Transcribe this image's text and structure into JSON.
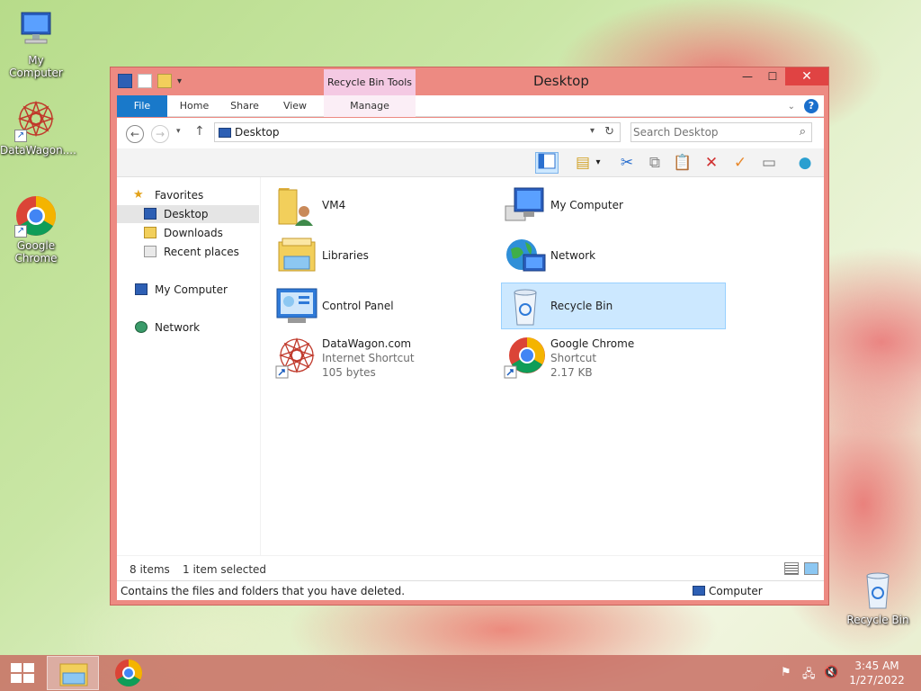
{
  "desktop": {
    "icons": [
      {
        "label": "My Computer"
      },
      {
        "label": "DataWagon...."
      },
      {
        "label": "Google Chrome"
      },
      {
        "label": "Recycle Bin"
      }
    ]
  },
  "window": {
    "title": "Desktop",
    "contextual_tab_group": "Recycle Bin Tools",
    "ribbon_tabs": [
      "File",
      "Home",
      "Share",
      "View",
      "Manage"
    ],
    "address": "Desktop",
    "search_placeholder": "Search Desktop",
    "colors": {
      "frame": "#ed8a82",
      "file_tab": "#1979ca",
      "close": "#e04343",
      "selection": "#cce8ff"
    }
  },
  "nav_pane": {
    "favorites": "Favorites",
    "items": [
      "Desktop",
      "Downloads",
      "Recent places"
    ],
    "computer": "My Computer",
    "network": "Network"
  },
  "files": [
    {
      "name": "VM4",
      "icon": "user-folder-icon"
    },
    {
      "name": "My Computer",
      "icon": "computer-icon"
    },
    {
      "name": "Libraries",
      "icon": "libraries-icon"
    },
    {
      "name": "Network",
      "icon": "network-icon"
    },
    {
      "name": "Control Panel",
      "icon": "control-panel-icon"
    },
    {
      "name": "Recycle Bin",
      "icon": "recycle-bin-icon",
      "selected": true
    },
    {
      "name": "DataWagon.com",
      "type": "Internet Shortcut",
      "size": "105 bytes",
      "icon": "datawagon-icon"
    },
    {
      "name": "Google Chrome",
      "type": "Shortcut",
      "size": "2.17 KB",
      "icon": "chrome-icon"
    }
  ],
  "status": {
    "items": "8 items",
    "selected": "1 item selected",
    "info": "Contains the files and folders that you have deleted.",
    "location": "Computer"
  },
  "taskbar": {
    "time": "3:45 AM",
    "date": "1/27/2022"
  }
}
